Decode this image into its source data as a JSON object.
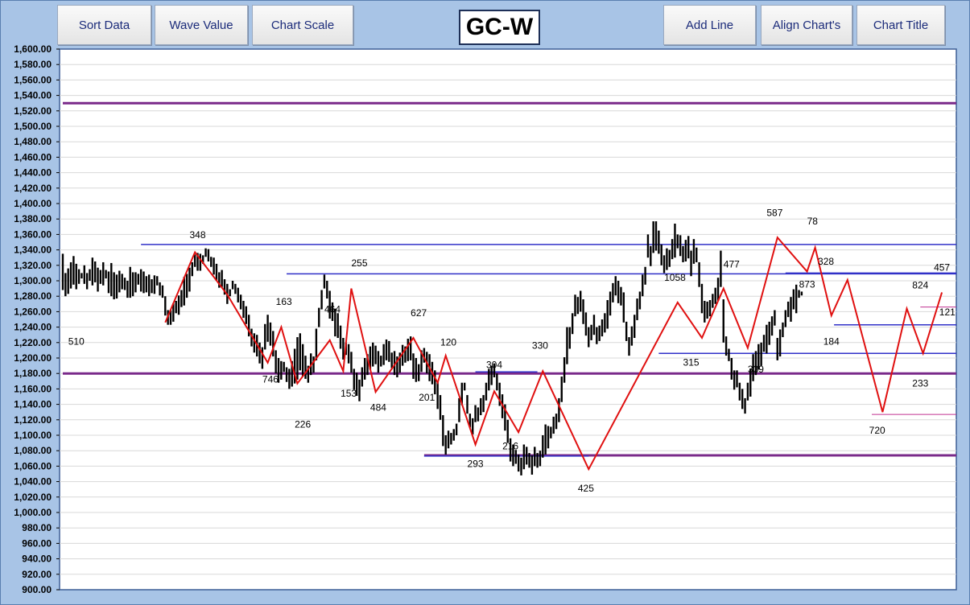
{
  "toolbar": {
    "sort_data": "Sort Data",
    "wave_value": "Wave Value",
    "chart_scale": "Chart Scale",
    "add_line": "Add Line",
    "align_charts": "Align Chart's",
    "chart_title": "Chart Title"
  },
  "chart_title": "GC-W",
  "chart_data": {
    "type": "ohlc",
    "title": "GC-W",
    "ylim": [
      900,
      1600
    ],
    "ytick_step": 20,
    "grid": true,
    "colors": {
      "bars": "#000000",
      "wave": "#e01010",
      "support": "#7a2a8a",
      "level": "#3030c8",
      "thin": "#c03090"
    },
    "bars_count": 275,
    "bar_values": [
      [
        1288,
        1335
      ],
      [
        1280,
        1310
      ],
      [
        1283,
        1316
      ],
      [
        1290,
        1324
      ],
      [
        1295,
        1332
      ],
      [
        1289,
        1322
      ],
      [
        1296,
        1315
      ],
      [
        1303,
        1310
      ],
      [
        1296,
        1320
      ],
      [
        1289,
        1310
      ],
      [
        1300,
        1315
      ],
      [
        1294,
        1330
      ],
      [
        1298,
        1325
      ],
      [
        1286,
        1317
      ],
      [
        1296,
        1314
      ],
      [
        1294,
        1324
      ],
      [
        1303,
        1314
      ],
      [
        1284,
        1312
      ],
      [
        1280,
        1323
      ],
      [
        1276,
        1311
      ],
      [
        1277,
        1308
      ],
      [
        1285,
        1313
      ],
      [
        1289,
        1309
      ],
      [
        1288,
        1304
      ],
      [
        1278,
        1300
      ],
      [
        1278,
        1318
      ],
      [
        1280,
        1311
      ],
      [
        1285,
        1311
      ],
      [
        1295,
        1309
      ],
      [
        1286,
        1315
      ],
      [
        1284,
        1312
      ],
      [
        1285,
        1306
      ],
      [
        1280,
        1308
      ],
      [
        1284,
        1302
      ],
      [
        1283,
        1307
      ],
      [
        1294,
        1306
      ],
      [
        1281,
        1298
      ],
      [
        1278,
        1294
      ],
      [
        1255,
        1280
      ],
      [
        1243,
        1262
      ],
      [
        1243,
        1262
      ],
      [
        1247,
        1271
      ],
      [
        1258,
        1274
      ],
      [
        1256,
        1281
      ],
      [
        1266,
        1288
      ],
      [
        1268,
        1305
      ],
      [
        1278,
        1309
      ],
      [
        1286,
        1317
      ],
      [
        1306,
        1324
      ],
      [
        1318,
        1334
      ],
      [
        1313,
        1336
      ],
      [
        1313,
        1335
      ],
      [
        1322,
        1333
      ],
      [
        1331,
        1342
      ],
      [
        1325,
        1341
      ],
      [
        1318,
        1331
      ],
      [
        1308,
        1330
      ],
      [
        1300,
        1322
      ],
      [
        1291,
        1311
      ],
      [
        1292,
        1314
      ],
      [
        1282,
        1302
      ],
      [
        1270,
        1296
      ],
      [
        1280,
        1289
      ],
      [
        1289,
        1300
      ],
      [
        1283,
        1296
      ],
      [
        1272,
        1291
      ],
      [
        1263,
        1282
      ],
      [
        1252,
        1274
      ],
      [
        1244,
        1267
      ],
      [
        1228,
        1256
      ],
      [
        1215,
        1238
      ],
      [
        1207,
        1232
      ],
      [
        1202,
        1230
      ],
      [
        1193,
        1220
      ],
      [
        1186,
        1214
      ],
      [
        1211,
        1244
      ],
      [
        1221,
        1256
      ],
      [
        1216,
        1246
      ],
      [
        1202,
        1235
      ],
      [
        1180,
        1210
      ],
      [
        1168,
        1200
      ],
      [
        1172,
        1196
      ],
      [
        1182,
        1195
      ],
      [
        1169,
        1188
      ],
      [
        1160,
        1186
      ],
      [
        1163,
        1196
      ],
      [
        1167,
        1212
      ],
      [
        1172,
        1227
      ],
      [
        1184,
        1232
      ],
      [
        1176,
        1218
      ],
      [
        1173,
        1203
      ],
      [
        1168,
        1190
      ],
      [
        1178,
        1206
      ],
      [
        1181,
        1202
      ],
      [
        1197,
        1238
      ],
      [
        1240,
        1265
      ],
      [
        1263,
        1288
      ],
      [
        1290,
        1308
      ],
      [
        1277,
        1300
      ],
      [
        1251,
        1287
      ],
      [
        1248,
        1272
      ],
      [
        1228,
        1264
      ],
      [
        1226,
        1258
      ],
      [
        1212,
        1242
      ],
      [
        1198,
        1226
      ],
      [
        1204,
        1220
      ],
      [
        1193,
        1218
      ],
      [
        1181,
        1208
      ],
      [
        1159,
        1186
      ],
      [
        1151,
        1181
      ],
      [
        1144,
        1172
      ],
      [
        1163,
        1188
      ],
      [
        1172,
        1200
      ],
      [
        1178,
        1205
      ],
      [
        1185,
        1215
      ],
      [
        1189,
        1220
      ],
      [
        1192,
        1216
      ],
      [
        1181,
        1209
      ],
      [
        1189,
        1203
      ],
      [
        1191,
        1218
      ],
      [
        1197,
        1224
      ],
      [
        1195,
        1222
      ],
      [
        1187,
        1207
      ],
      [
        1178,
        1209
      ],
      [
        1175,
        1202
      ],
      [
        1181,
        1207
      ],
      [
        1190,
        1217
      ],
      [
        1194,
        1215
      ],
      [
        1196,
        1225
      ],
      [
        1197,
        1228
      ],
      [
        1173,
        1206
      ],
      [
        1169,
        1200
      ],
      [
        1170,
        1192
      ],
      [
        1182,
        1210
      ],
      [
        1194,
        1213
      ],
      [
        1180,
        1208
      ],
      [
        1170,
        1205
      ],
      [
        1166,
        1195
      ],
      [
        1153,
        1184
      ],
      [
        1134,
        1170
      ],
      [
        1120,
        1152
      ],
      [
        1086,
        1126
      ],
      [
        1075,
        1100
      ],
      [
        1083,
        1106
      ],
      [
        1088,
        1103
      ],
      [
        1093,
        1108
      ],
      [
        1100,
        1115
      ],
      [
        1117,
        1148
      ],
      [
        1139,
        1168
      ],
      [
        1158,
        1168
      ],
      [
        1128,
        1152
      ],
      [
        1110,
        1128
      ],
      [
        1101,
        1122
      ],
      [
        1117,
        1139
      ],
      [
        1118,
        1136
      ],
      [
        1126,
        1148
      ],
      [
        1130,
        1152
      ],
      [
        1145,
        1168
      ],
      [
        1158,
        1186
      ],
      [
        1165,
        1190
      ],
      [
        1175,
        1193
      ],
      [
        1158,
        1180
      ],
      [
        1138,
        1168
      ],
      [
        1122,
        1153
      ],
      [
        1106,
        1140
      ],
      [
        1090,
        1120
      ],
      [
        1066,
        1096
      ],
      [
        1060,
        1088
      ],
      [
        1063,
        1081
      ],
      [
        1053,
        1075
      ],
      [
        1048,
        1071
      ],
      [
        1056,
        1088
      ],
      [
        1062,
        1085
      ],
      [
        1058,
        1077
      ],
      [
        1049,
        1074
      ],
      [
        1060,
        1085
      ],
      [
        1058,
        1077
      ],
      [
        1060,
        1080
      ],
      [
        1071,
        1100
      ],
      [
        1075,
        1114
      ],
      [
        1083,
        1112
      ],
      [
        1096,
        1111
      ],
      [
        1102,
        1124
      ],
      [
        1108,
        1128
      ],
      [
        1117,
        1148
      ],
      [
        1143,
        1176
      ],
      [
        1168,
        1201
      ],
      [
        1192,
        1240
      ],
      [
        1212,
        1240
      ],
      [
        1231,
        1258
      ],
      [
        1254,
        1282
      ],
      [
        1257,
        1279
      ],
      [
        1260,
        1287
      ],
      [
        1244,
        1276
      ],
      [
        1229,
        1259
      ],
      [
        1214,
        1240
      ],
      [
        1223,
        1243
      ],
      [
        1230,
        1256
      ],
      [
        1218,
        1240
      ],
      [
        1222,
        1242
      ],
      [
        1228,
        1250
      ],
      [
        1233,
        1258
      ],
      [
        1238,
        1275
      ],
      [
        1255,
        1286
      ],
      [
        1272,
        1297
      ],
      [
        1281,
        1306
      ],
      [
        1271,
        1300
      ],
      [
        1268,
        1292
      ],
      [
        1246,
        1285
      ],
      [
        1222,
        1247
      ],
      [
        1203,
        1227
      ],
      [
        1216,
        1241
      ],
      [
        1226,
        1256
      ],
      [
        1249,
        1277
      ],
      [
        1263,
        1286
      ],
      [
        1280,
        1308
      ],
      [
        1295,
        1318
      ],
      [
        1330,
        1360
      ],
      [
        1319,
        1345
      ],
      [
        1336,
        1377
      ],
      [
        1339,
        1377
      ],
      [
        1335,
        1365
      ],
      [
        1320,
        1347
      ],
      [
        1310,
        1333
      ],
      [
        1314,
        1342
      ],
      [
        1318,
        1340
      ],
      [
        1328,
        1354
      ],
      [
        1330,
        1374
      ],
      [
        1342,
        1360
      ],
      [
        1332,
        1359
      ],
      [
        1324,
        1345
      ],
      [
        1325,
        1353
      ],
      [
        1329,
        1358
      ],
      [
        1306,
        1339
      ],
      [
        1322,
        1354
      ],
      [
        1324,
        1343
      ],
      [
        1292,
        1324
      ],
      [
        1258,
        1296
      ],
      [
        1246,
        1274
      ],
      [
        1251,
        1273
      ],
      [
        1254,
        1275
      ],
      [
        1265,
        1283
      ],
      [
        1270,
        1291
      ],
      [
        1274,
        1304
      ],
      [
        1292,
        1339
      ],
      [
        1220,
        1276
      ],
      [
        1203,
        1228
      ],
      [
        1196,
        1212
      ],
      [
        1172,
        1200
      ],
      [
        1159,
        1184
      ],
      [
        1162,
        1184
      ],
      [
        1145,
        1168
      ],
      [
        1134,
        1160
      ],
      [
        1128,
        1148
      ],
      [
        1145,
        1168
      ],
      [
        1150,
        1186
      ],
      [
        1170,
        1205
      ],
      [
        1178,
        1209
      ],
      [
        1185,
        1218
      ],
      [
        1190,
        1220
      ],
      [
        1208,
        1230
      ],
      [
        1206,
        1243
      ],
      [
        1217,
        1247
      ],
      [
        1229,
        1254
      ],
      [
        1242,
        1262
      ],
      [
        1197,
        1226
      ],
      [
        1202,
        1237
      ],
      [
        1227,
        1246
      ],
      [
        1240,
        1262
      ],
      [
        1253,
        1273
      ],
      [
        1247,
        1279
      ],
      [
        1263,
        1289
      ],
      [
        1258,
        1295
      ],
      [
        1278,
        1288
      ],
      [
        1281,
        1286
      ]
    ],
    "wave_points": [
      [
        38,
        1246
      ],
      [
        49,
        1337
      ],
      [
        61,
        1282
      ],
      [
        76,
        1194
      ],
      [
        81,
        1240
      ],
      [
        87,
        1167
      ],
      [
        99,
        1223
      ],
      [
        104,
        1183
      ],
      [
        107,
        1290
      ],
      [
        116,
        1156
      ],
      [
        130,
        1226
      ],
      [
        139,
        1168
      ],
      [
        142,
        1203
      ],
      [
        145,
        1172
      ],
      [
        153,
        1088
      ],
      [
        160,
        1157
      ],
      [
        169,
        1104
      ],
      [
        178,
        1183
      ],
      [
        195,
        1056
      ],
      [
        228,
        1272
      ],
      [
        237,
        1226
      ],
      [
        245,
        1290
      ],
      [
        254,
        1213
      ],
      [
        265,
        1356
      ],
      [
        276,
        1312
      ],
      [
        279,
        1343
      ],
      [
        285,
        1255
      ],
      [
        291,
        1301
      ],
      [
        304,
        1130
      ],
      [
        313,
        1264
      ],
      [
        319,
        1206
      ],
      [
        326,
        1285
      ]
    ],
    "wave_labels": [
      {
        "x": 5,
        "y": 1217,
        "text": "510"
      },
      {
        "x": 50,
        "y": 1355,
        "text": "348"
      },
      {
        "x": 77,
        "y": 1168,
        "text": "746"
      },
      {
        "x": 82,
        "y": 1269,
        "text": "163"
      },
      {
        "x": 89,
        "y": 1110,
        "text": "226"
      },
      {
        "x": 100,
        "y": 1259,
        "text": "464"
      },
      {
        "x": 106,
        "y": 1150,
        "text": "153"
      },
      {
        "x": 110,
        "y": 1319,
        "text": "255"
      },
      {
        "x": 117,
        "y": 1132,
        "text": "484"
      },
      {
        "x": 132,
        "y": 1254,
        "text": "627"
      },
      {
        "x": 135,
        "y": 1145,
        "text": "201"
      },
      {
        "x": 143,
        "y": 1216,
        "text": "120"
      },
      {
        "x": 153,
        "y": 1059,
        "text": "293"
      },
      {
        "x": 160,
        "y": 1187,
        "text": "304"
      },
      {
        "x": 166,
        "y": 1082,
        "text": "216"
      },
      {
        "x": 177,
        "y": 1212,
        "text": "330"
      },
      {
        "x": 194,
        "y": 1027,
        "text": "425"
      },
      {
        "x": 227,
        "y": 1300,
        "text": "1058"
      },
      {
        "x": 233,
        "y": 1190,
        "text": "315"
      },
      {
        "x": 248,
        "y": 1317,
        "text": "477"
      },
      {
        "x": 257,
        "y": 1181,
        "text": "339"
      },
      {
        "x": 264,
        "y": 1384,
        "text": "587"
      },
      {
        "x": 278,
        "y": 1373,
        "text": "78"
      },
      {
        "x": 276,
        "y": 1291,
        "text": "873"
      },
      {
        "x": 283,
        "y": 1321,
        "text": "328"
      },
      {
        "x": 285,
        "y": 1217,
        "text": "184"
      },
      {
        "x": 302,
        "y": 1102,
        "text": "720"
      },
      {
        "x": 318,
        "y": 1290,
        "text": "824"
      },
      {
        "x": 318,
        "y": 1163,
        "text": "233"
      },
      {
        "x": 326,
        "y": 1313,
        "text": "457"
      },
      {
        "x": 328,
        "y": 1255,
        "text": "121"
      }
    ],
    "hlines": [
      {
        "y": 1530,
        "x1": 0,
        "x2": 341,
        "style": "support"
      },
      {
        "y": 1180,
        "x1": 0,
        "x2": 341,
        "style": "support"
      },
      {
        "y": 1074,
        "x1": 134,
        "x2": 341,
        "style": "support"
      },
      {
        "y": 1347,
        "x1": 29,
        "x2": 341,
        "style": "level"
      },
      {
        "y": 1309,
        "x1": 83,
        "x2": 342,
        "style": "level"
      },
      {
        "y": 1310,
        "x1": 268,
        "x2": 341,
        "style": "level"
      },
      {
        "y": 1206,
        "x1": 221,
        "x2": 341,
        "style": "level"
      },
      {
        "y": 1243,
        "x1": 286,
        "x2": 341,
        "style": "level"
      },
      {
        "y": 1073,
        "x1": 134,
        "x2": 195,
        "style": "level"
      },
      {
        "y": 1182,
        "x1": 153,
        "x2": 176,
        "style": "level"
      },
      {
        "y": 1127,
        "x1": 300,
        "x2": 341,
        "style": "thin"
      },
      {
        "y": 1266,
        "x1": 318,
        "x2": 337,
        "style": "thin"
      }
    ]
  }
}
